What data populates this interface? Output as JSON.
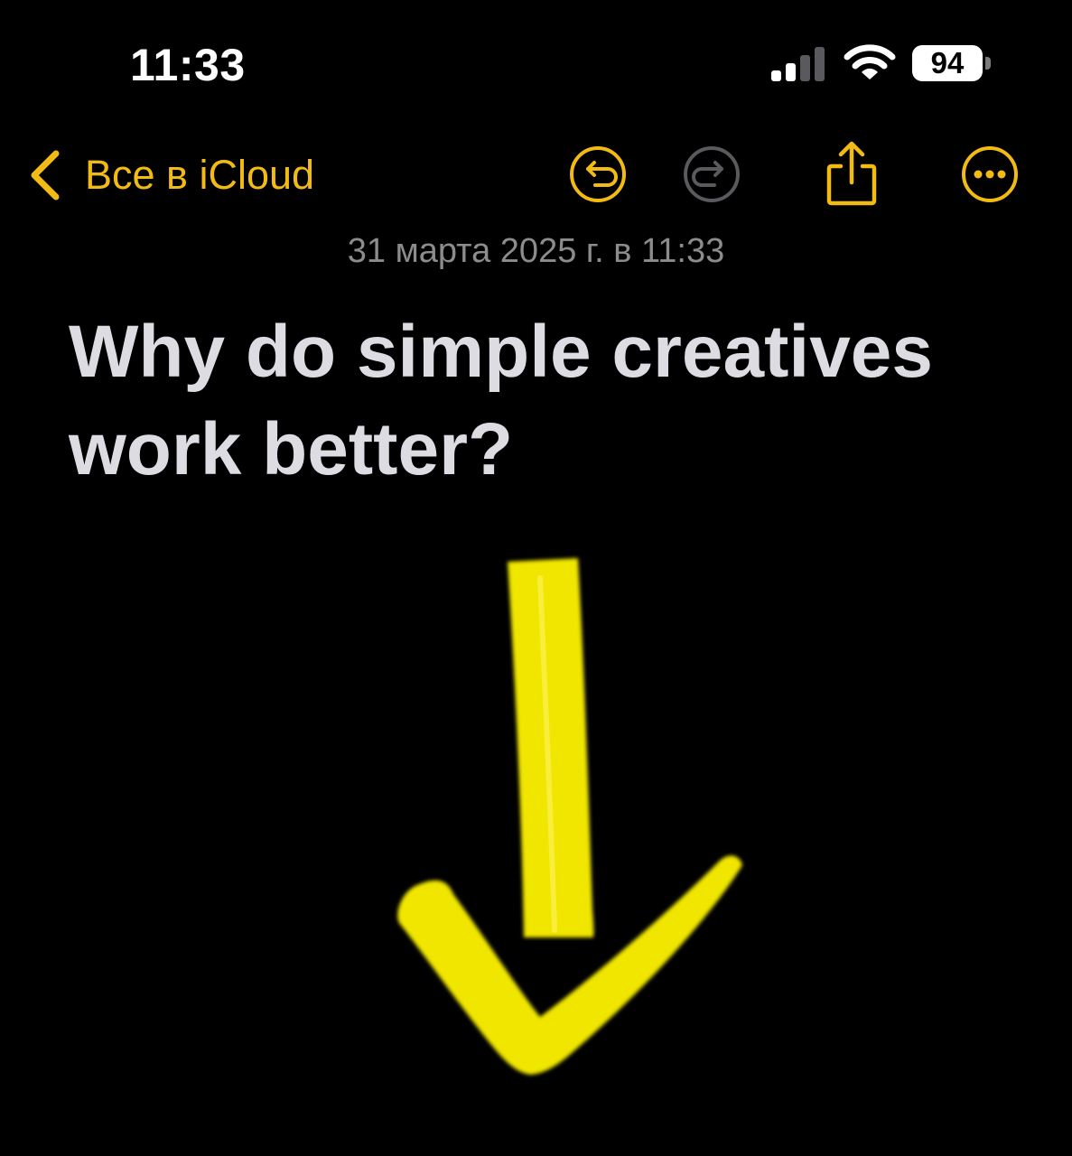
{
  "status_bar": {
    "time": "11:33",
    "battery_level": "94",
    "signal_bars_active": 2,
    "signal_bars_total": 4
  },
  "nav": {
    "back_label": "Все в iCloud",
    "icons": [
      "chevron-left-icon",
      "undo-icon",
      "redo-icon",
      "share-icon",
      "more-icon"
    ]
  },
  "note": {
    "date": "31 марта 2025 г. в 11:33",
    "title": "Why do simple creatives work better?",
    "drawing": "arrow-down-icon"
  },
  "colors": {
    "accent": "#f2bb13",
    "drawing": "#f0e600",
    "background": "#000000",
    "title": "#dcdce2",
    "date": "#8c8c8c",
    "disabled_icon": "#5a5a5e"
  }
}
